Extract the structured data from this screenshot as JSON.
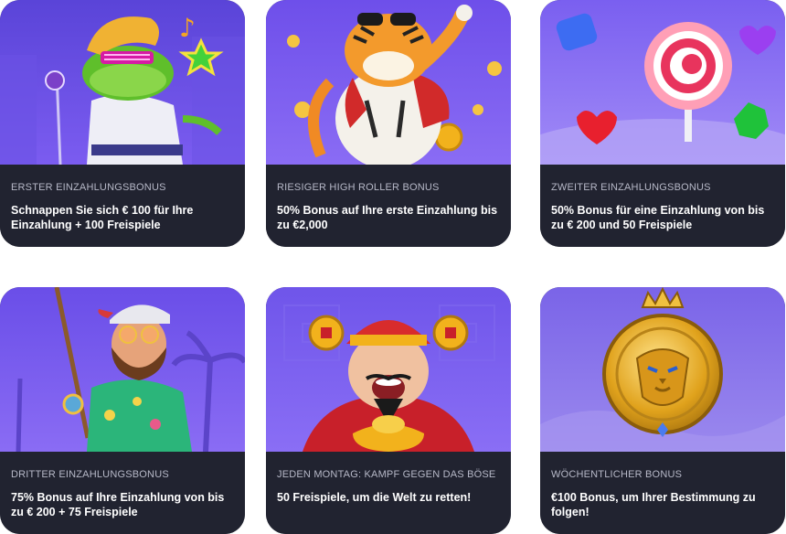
{
  "promotions": [
    {
      "kicker": "ERSTER EINZAHLUNGSBONUS",
      "title": "Schnappen Sie sich € 100 für Ihre Einzahlung + 100 Freispiele",
      "artwork": "frog-singer-illustration"
    },
    {
      "kicker": "RIESIGER HIGH ROLLER BONUS",
      "title": "50% Bonus auf Ihre erste Einzahlung bis zu €2,000",
      "artwork": "fortune-tiger-illustration"
    },
    {
      "kicker": "ZWEITER EINZAHLUNGSBONUS",
      "title": "50% Bonus für eine Einzahlung von bis zu € 200 und 50 Freispiele",
      "artwork": "candy-lollipop-illustration"
    },
    {
      "kicker": "DRITTER EINZAHLUNGSBONUS",
      "title": "75% Bonus auf Ihre Einzahlung von bis zu € 200 + 75 Freispiele",
      "artwork": "fisherman-illustration"
    },
    {
      "kicker": "JEDEN MONTAG: KAMPF GEGEN DAS BÖSE",
      "title": "50 Freispiele, um die Welt zu retten!",
      "artwork": "fortune-god-illustration"
    },
    {
      "kicker": "WÖCHENTLICHER BONUS",
      "title": "€100 Bonus, um Ihrer Bestimmung zu folgen!",
      "artwork": "golden-lion-medallion-illustration"
    }
  ],
  "colors": {
    "card_background": "#212330",
    "kicker_text": "#b7b9c8",
    "title_text": "#ffffff",
    "art_purple": "#6d55e6"
  }
}
